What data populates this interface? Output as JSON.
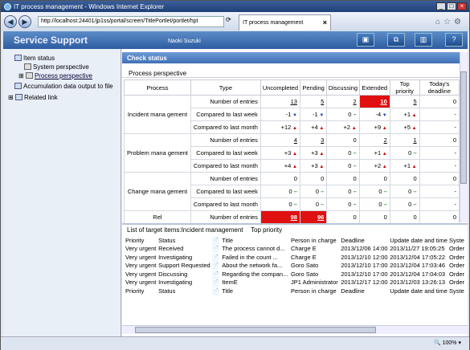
{
  "window": {
    "title": "IT process management - Windows Internet Explorer"
  },
  "browser": {
    "url": "http://localhost:24401/jp1ss/portal/screen/TitlePortlet/portlet/hpt",
    "tab_title": "IT process management"
  },
  "header": {
    "brand": "Service Support",
    "user": "Naoki Suzuki"
  },
  "sidebar": {
    "item_status": "Item status",
    "system_perspective": "System perspective",
    "process_perspective": "Process perspective",
    "accumulation": "Accumulation data output to file",
    "related_link": "Related link"
  },
  "check_status": {
    "title": "Check status",
    "subtitle": "Process perspective"
  },
  "columns": [
    "Process",
    "Type",
    "Uncompleted",
    "Pending",
    "Discussing",
    "Extended",
    "Top priority",
    "Today's deadline"
  ],
  "groups": [
    {
      "process": "Incident mana gement",
      "rows": [
        {
          "type": "Number of entries",
          "cells": [
            [
              "13",
              "u"
            ],
            [
              "5",
              "u"
            ],
            [
              "2",
              "u"
            ],
            [
              "10",
              "red"
            ],
            [
              "5",
              "u"
            ],
            [
              "0",
              ""
            ]
          ]
        },
        {
          "type": "Compared to last week",
          "cells": [
            [
              "-1",
              "dn"
            ],
            [
              "-1",
              "dn"
            ],
            [
              "0",
              "fl"
            ],
            [
              "-4",
              "dn"
            ],
            [
              "+1",
              "up"
            ],
            [
              "-",
              ""
            ]
          ]
        },
        {
          "type": "Compared to last month",
          "cells": [
            [
              "+12",
              "up"
            ],
            [
              "+4",
              "up"
            ],
            [
              "+2",
              "up"
            ],
            [
              "+9",
              "up"
            ],
            [
              "+5",
              "up"
            ],
            [
              "-",
              ""
            ]
          ]
        }
      ]
    },
    {
      "process": "Problem mana gement",
      "rows": [
        {
          "type": "Number of entries",
          "cells": [
            [
              "4",
              "u"
            ],
            [
              "3",
              "u"
            ],
            [
              "0",
              ""
            ],
            [
              "2",
              "u"
            ],
            [
              "1",
              "u"
            ],
            [
              "0",
              ""
            ]
          ]
        },
        {
          "type": "Compared to last week",
          "cells": [
            [
              "+3",
              "up"
            ],
            [
              "+3",
              "up"
            ],
            [
              "0",
              "fl"
            ],
            [
              "+1",
              "up"
            ],
            [
              "0",
              "fl"
            ],
            [
              "-",
              ""
            ]
          ]
        },
        {
          "type": "Compared to last month",
          "cells": [
            [
              "+4",
              "up"
            ],
            [
              "+3",
              "up"
            ],
            [
              "0",
              "fl"
            ],
            [
              "+2",
              "up"
            ],
            [
              "+1",
              "up"
            ],
            [
              "-",
              ""
            ]
          ]
        }
      ]
    },
    {
      "process": "Change mana gement",
      "rows": [
        {
          "type": "Number of entries",
          "cells": [
            [
              "0",
              ""
            ],
            [
              "0",
              ""
            ],
            [
              "0",
              ""
            ],
            [
              "0",
              ""
            ],
            [
              "0",
              ""
            ],
            [
              "0",
              ""
            ]
          ]
        },
        {
          "type": "Compared to last week",
          "cells": [
            [
              "0",
              "fl"
            ],
            [
              "0",
              "fl"
            ],
            [
              "0",
              "fl"
            ],
            [
              "0",
              "fl"
            ],
            [
              "0",
              "fl"
            ],
            [
              "-",
              ""
            ]
          ]
        },
        {
          "type": "Compared to last month",
          "cells": [
            [
              "0",
              "fl"
            ],
            [
              "0",
              "fl"
            ],
            [
              "0",
              "fl"
            ],
            [
              "0",
              "fl"
            ],
            [
              "0",
              "fl"
            ],
            [
              "-",
              ""
            ]
          ]
        }
      ]
    },
    {
      "process": "Rel",
      "rows": [
        {
          "type": "Number of entries",
          "cells": [
            [
              "98",
              "red"
            ],
            [
              "96",
              "red"
            ],
            [
              "0",
              ""
            ],
            [
              "0",
              ""
            ],
            [
              "0",
              ""
            ],
            [
              "0",
              ""
            ]
          ]
        }
      ]
    }
  ],
  "list": {
    "title": "List of target items:Incident management",
    "priority_link": "Top priority",
    "headers": [
      "Priority",
      "Status",
      "",
      "Title",
      "Person in charge",
      "Deadline",
      "Update date and time",
      "Syste"
    ],
    "rows": [
      [
        "Very urgent",
        "Received",
        "The process cannot d...",
        "Charge E",
        "2013/12/06 14:00",
        "2013/11/27 19:05:25",
        "Order"
      ],
      [
        "Very urgent",
        "Investigating",
        "Failed in the count ...",
        "Charge E",
        "2013/12/10 12:00",
        "2013/12/04 17:05:22",
        "Order"
      ],
      [
        "Very urgent",
        "Support Requested",
        "About the network fa...",
        "Goro Sato",
        "2013/12/10 17:00",
        "2013/12/04 17:03:46",
        "Order"
      ],
      [
        "Very urgent",
        "Discussing",
        "Regarding the compan...",
        "Goro Sato",
        "2013/12/10 17:00",
        "2013/12/04 17:04:03",
        "Order"
      ],
      [
        "Very urgent",
        "Investigating",
        "ItemE",
        "JP1 Administrator",
        "2013/12/17 12:00",
        "2013/12/03 13:26:13",
        "Order"
      ]
    ]
  },
  "status": {
    "zoom": "100%"
  }
}
